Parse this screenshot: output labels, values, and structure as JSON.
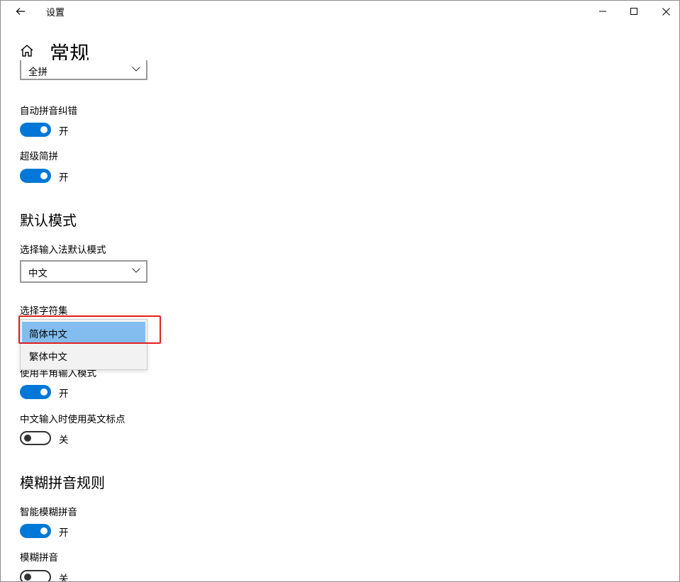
{
  "window": {
    "title": "设置"
  },
  "header": {
    "page_title": "常规"
  },
  "colors": {
    "accent": "#0078d7",
    "highlight": "#e02020",
    "selected_item": "#83bdf0"
  },
  "settings": {
    "top_combo_value": "全拼",
    "auto_correct": {
      "label": "自动拼音纠错",
      "state": "开"
    },
    "super_abbrev": {
      "label": "超级简拼",
      "state": "开"
    },
    "default_mode": {
      "section_title": "默认模式",
      "select_label": "选择输入法默认模式",
      "select_value": "中文"
    },
    "charset": {
      "label": "选择字符集",
      "options": [
        "简体中文",
        "繁体中文"
      ],
      "selected": "简体中文"
    },
    "halfwidth": {
      "label": "使用半角输入模式",
      "state": "开"
    },
    "english_punct": {
      "label": "中文输入时使用英文标点",
      "state": "关"
    },
    "fuzzy": {
      "section_title": "模糊拼音规则",
      "smart": {
        "label": "智能模糊拼音",
        "state": "开"
      },
      "fuzzy_pinyin": {
        "label": "模糊拼音",
        "state": "关"
      }
    }
  }
}
